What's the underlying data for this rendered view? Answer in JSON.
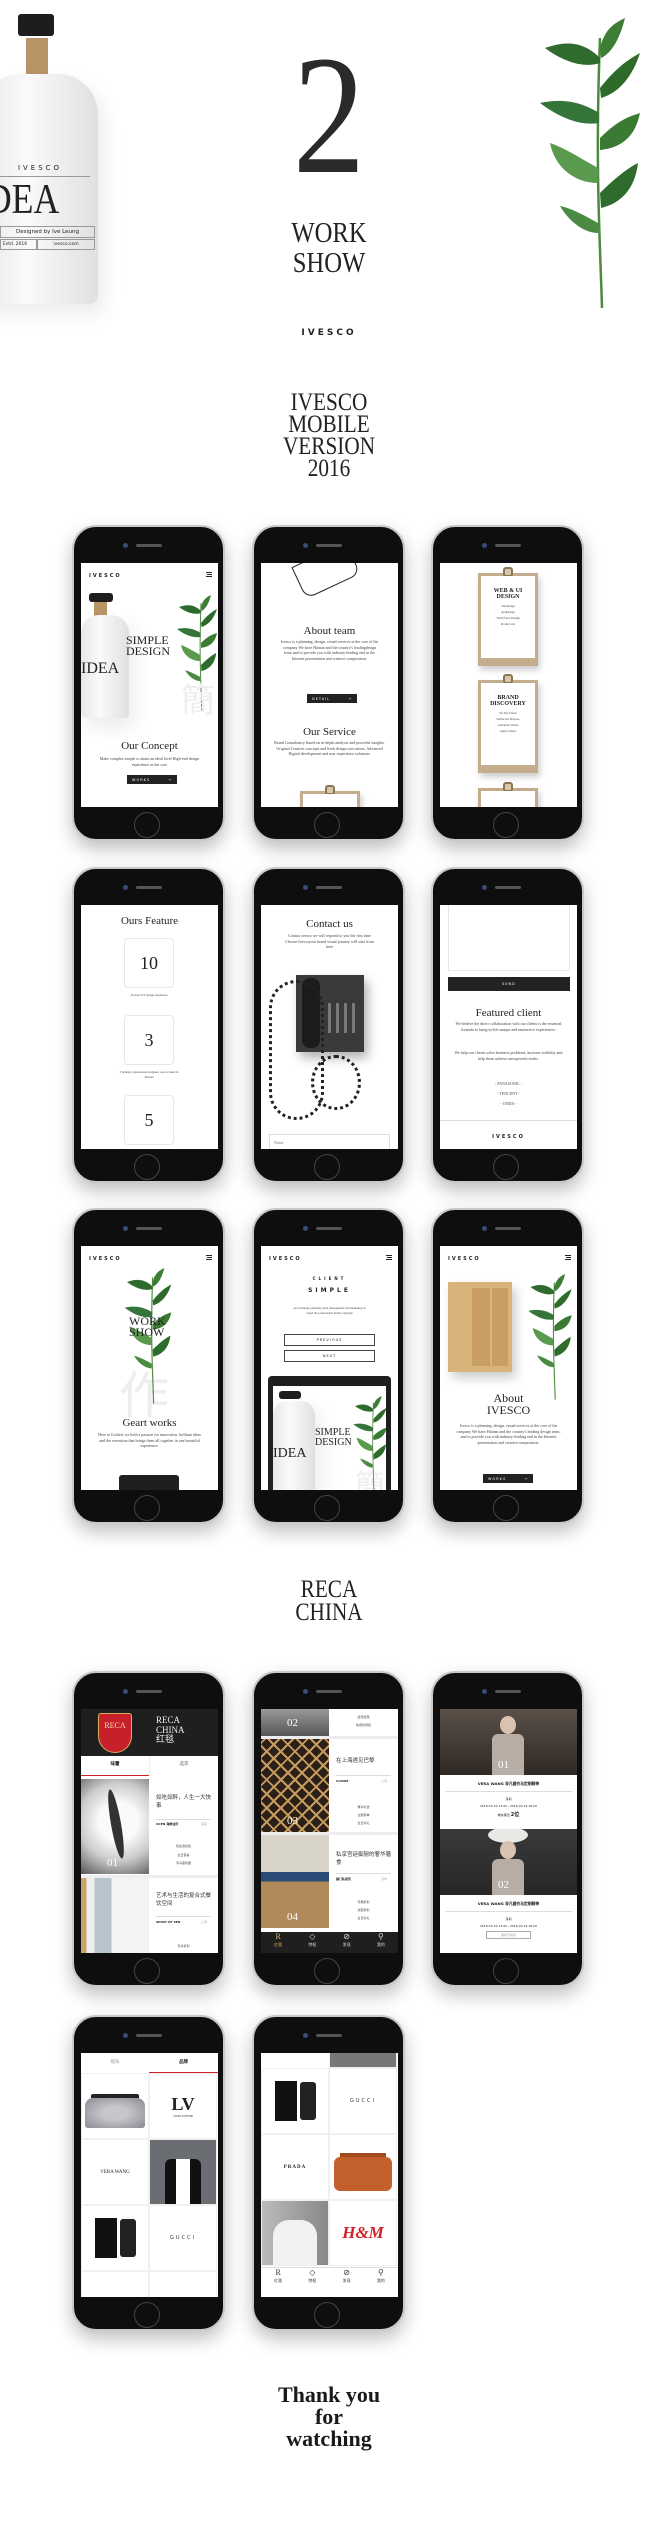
{
  "header": {
    "chapter_number": "2",
    "title_line1": "WORK",
    "title_line2": "SHOW",
    "logo": "IVESCO",
    "section1_lines": [
      "IVESCO",
      "MOBILE",
      "VERSION",
      "2016"
    ],
    "section2_lines": [
      "RECA",
      "CHINA"
    ],
    "closing_lines": [
      "Thank you",
      "for",
      "watching"
    ]
  },
  "hero_bottle": {
    "brand": "IVESCO",
    "label": "IDEA",
    "designed_by": "Designed by Ive Leung",
    "estd": "Estd. 2016",
    "site": "ivesco.com"
  },
  "ivesco_screens": {
    "home": {
      "logo": "IVESCO",
      "headline_line1": "SIMPLE",
      "headline_line2": "DESIGN",
      "bottle_label": "IDEA",
      "watermark": "簡",
      "concept_title": "Our Concept",
      "concept_text": "Make complex simple to attain an ideal level High-end design experience as the core",
      "works_button": "WORKS"
    },
    "about": {
      "team_title": "About team",
      "team_text": "Ivesco is a planning, design, visual services at the core of the company We have Hainan and the country's leadingdesign team and to provide you with industry-leading end in the Internet presentation and creative composition.",
      "detail_button": "DETAIL",
      "service_title": "Our Service",
      "service_text": "Brand Consultancy based on in-depth analysis and powerful insights. Original Creative concepts and fresh design executions. Advanced Digital development and user experience solutions."
    },
    "services": {
      "cards": [
        {
          "title": "WEB & UI DESIGN",
          "items": [
            "Webdesign",
            "AppDesign",
            "Tmall Store Design",
            "Product site"
          ]
        },
        {
          "title": "BRAND DISCOVERY",
          "items": [
            "Set The Vision",
            "Define the Purpose",
            "Articulate Values",
            "Align Culture"
          ]
        }
      ]
    },
    "features": {
      "title": "Ours Feature",
      "items": [
        {
          "value": "10",
          "caption": "10 years UX design experience"
        },
        {
          "value": "3",
          "caption": "3 industry experienced designers once worked in Tencent"
        },
        {
          "value": "5",
          "caption": ""
        }
      ]
    },
    "contact": {
      "title": "Contact us",
      "text": "Contact ivesco we will respond to you the first time Choose Ivescoyour brand visual journey will start from here",
      "name_placeholder": "Name"
    },
    "clients": {
      "send_button": "SEND",
      "title": "Featured client",
      "text1": "We believe the direct collaboration with our clients is the essential formula to bring-to-life unique and immersive experiences.",
      "text2": "We help our clients solve business problems, increase visibility and help them achieve unexpected results.",
      "list": [
        "- PANASONIC -",
        "- TENCENT -",
        "- ONDA -"
      ],
      "footer_logo": "IVESCO"
    },
    "works": {
      "logo": "IVESCO",
      "headline_line1": "WORK",
      "headline_line2": "SHOW",
      "watermark": "作",
      "title": "Geart works",
      "text": "Here at Crafted, we hold a passion for innovation, brilliant ideas and the execution that brings them all together in one beautiful experience."
    },
    "client": {
      "logo": "IVESCO",
      "eyebrow": "CLIENT",
      "name": "SIMPLE",
      "text": "Art exchange planning, artist management and marketing in round the professional media company",
      "previous_button": "PREVIOUS",
      "next_button": "NEXT",
      "preview_line1": "SIMPLE",
      "preview_line2": "DESIGN",
      "preview_label": "IDEA",
      "preview_watermark": "簡"
    },
    "about_ivesco": {
      "logo": "IVESCO",
      "title_line1": "About",
      "title_line2": "IVESCO",
      "text": "Ivesco is a planning, design, visual services at the core of the company We have Hainan and the country's leading design team, and to provide you with industry-leading end in the Internet presentation and creative composition.",
      "works_button": "WORKS"
    }
  },
  "reca_screens": {
    "home": {
      "brand_line1": "RECA",
      "brand_line2": "CHINA",
      "brand_cn": "红毯",
      "crest": "RECA",
      "tabs": [
        {
          "label": "味蕾",
          "active": true
        },
        {
          "label": "选衣",
          "active": false
        }
      ],
      "cards": [
        {
          "number": "01",
          "title": "如吃如醉，人生一大快事",
          "venue": "OCEN 海鲜会所",
          "city": "深圳",
          "perks": [
            "优先选位权",
            "生日惊喜",
            "专享座机服"
          ]
        },
        {
          "number": "",
          "title": "艺术与生活的复合式餐饮空间",
          "venue": "SPIRIT OF ZEN",
          "city": "上海",
          "perks": [
            "专享折扣"
          ]
        }
      ]
    },
    "list": {
      "cards": [
        {
          "number": "02",
          "title": "",
          "venue": "",
          "city": "",
          "perks": [
            "接待优惠",
            "免费机场接"
          ]
        },
        {
          "number": "03",
          "title": "在上海遇见巴黎",
          "venue": "CUIVRE",
          "city": "上海",
          "perks": [
            "尊享外送",
            "主厨菜单",
            "生日好礼"
          ]
        },
        {
          "number": "04",
          "title": "私享宫廷御厨的奢华膳食",
          "venue": "御门私宴所",
          "city": "深圳",
          "perks": [
            "专属折扣",
            "消费折扣",
            "生日好礼"
          ]
        }
      ],
      "nav": [
        {
          "icon": "r-logo-icon",
          "glyph": "R",
          "label": "红毯"
        },
        {
          "icon": "diamond-icon",
          "glyph": "◇",
          "label": "特权"
        },
        {
          "icon": "compass-icon",
          "glyph": "⊘",
          "label": "发现"
        },
        {
          "icon": "user-icon",
          "glyph": "⚲",
          "label": "我的"
        }
      ]
    },
    "events": {
      "items": [
        {
          "number": "01",
          "title": "VERA WANG 非凡婚衣与定制精神",
          "city": "深圳",
          "time": "2016-03-19 13:00 - 2016-03-19 18:00",
          "seats_label": "剩余席位",
          "seats": "2位",
          "button": ""
        },
        {
          "number": "02",
          "title": "VERA WANG 非凡婚衣与定制精神",
          "city": "深圳",
          "time": "2016-03-19 13:00 - 2016-03-19 18:00",
          "seats_label": "",
          "seats": "",
          "button": "报名不成功"
        }
      ]
    },
    "brands": {
      "tabs": [
        {
          "label": "玩乐",
          "active": false
        },
        {
          "label": "品牌",
          "active": true
        }
      ],
      "grid": [
        "bag-photo",
        "LV",
        "VERA WANG",
        "model-photo",
        "perfume-photo",
        "GUCCI"
      ],
      "lv_caption": "LOUIS VUITTON"
    },
    "brands2": {
      "grid": [
        "perfume-photo",
        "GUCCI",
        "PRADA",
        "orange-bag-photo",
        "man-photo",
        "H&M"
      ]
    }
  },
  "colors": {
    "accent_red": "#d0202a",
    "dark": "#1f1f1f",
    "leaf_green": "#3f7a3a",
    "clipboard_tan": "#c4ad8d"
  }
}
